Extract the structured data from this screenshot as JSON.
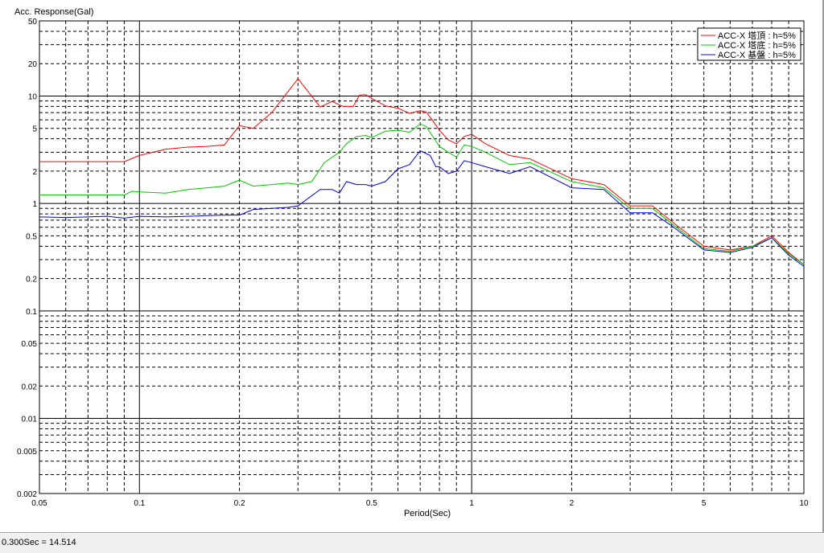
{
  "status_bar": {
    "readout": "0.300Sec = 14.514"
  },
  "chart_data": {
    "type": "line",
    "title": "",
    "ylabel": "Acc. Response(Gal)",
    "xlabel": "Period(Sec)",
    "x_scale": "log",
    "y_scale": "log",
    "xlim": [
      0.05,
      10
    ],
    "ylim": [
      0.002,
      50
    ],
    "grid": true,
    "legend_position": "top-right",
    "x_tick_labels": [
      {
        "value": 0.05,
        "label": "0.05"
      },
      {
        "value": 0.1,
        "label": "0.1"
      },
      {
        "value": 0.2,
        "label": "0.2"
      },
      {
        "value": 0.5,
        "label": "0.5"
      },
      {
        "value": 1,
        "label": "1"
      },
      {
        "value": 2,
        "label": "2"
      },
      {
        "value": 5,
        "label": "5"
      },
      {
        "value": 10,
        "label": "10"
      }
    ],
    "y_tick_labels": [
      {
        "value": 0.002,
        "label": "0.002"
      },
      {
        "value": 0.005,
        "label": "0.005"
      },
      {
        "value": 0.01,
        "label": "0.01"
      },
      {
        "value": 0.02,
        "label": "0.02"
      },
      {
        "value": 0.05,
        "label": "0.05"
      },
      {
        "value": 0.1,
        "label": "0.1"
      },
      {
        "value": 0.2,
        "label": "0.2"
      },
      {
        "value": 0.5,
        "label": "0.5"
      },
      {
        "value": 1,
        "label": "1"
      },
      {
        "value": 2,
        "label": "2"
      },
      {
        "value": 5,
        "label": "5"
      },
      {
        "value": 10,
        "label": "10"
      },
      {
        "value": 20,
        "label": "20"
      },
      {
        "value": 50,
        "label": "50"
      }
    ],
    "series": [
      {
        "name": "ACC-X 塔頂 : h=5%",
        "color": "#ff0000",
        "points": [
          [
            0.05,
            2.45
          ],
          [
            0.06,
            2.45
          ],
          [
            0.07,
            2.45
          ],
          [
            0.08,
            2.45
          ],
          [
            0.09,
            2.45
          ],
          [
            0.1,
            2.8
          ],
          [
            0.12,
            3.2
          ],
          [
            0.14,
            3.35
          ],
          [
            0.16,
            3.4
          ],
          [
            0.18,
            3.5
          ],
          [
            0.2,
            5.3
          ],
          [
            0.22,
            5.0
          ],
          [
            0.25,
            7.0
          ],
          [
            0.3,
            14.5
          ],
          [
            0.35,
            7.9
          ],
          [
            0.38,
            8.9
          ],
          [
            0.41,
            8.0
          ],
          [
            0.44,
            8.0
          ],
          [
            0.46,
            10.2
          ],
          [
            0.48,
            10.3
          ],
          [
            0.5,
            9.5
          ],
          [
            0.55,
            8.1
          ],
          [
            0.6,
            7.7
          ],
          [
            0.65,
            6.9
          ],
          [
            0.7,
            7.3
          ],
          [
            0.73,
            7.1
          ],
          [
            0.76,
            6.0
          ],
          [
            0.8,
            4.8
          ],
          [
            0.85,
            3.9
          ],
          [
            0.9,
            3.6
          ],
          [
            0.95,
            4.2
          ],
          [
            1.0,
            4.4
          ],
          [
            1.1,
            3.6
          ],
          [
            1.3,
            2.8
          ],
          [
            1.5,
            2.6
          ],
          [
            2.0,
            1.7
          ],
          [
            2.5,
            1.5
          ],
          [
            3.0,
            0.95
          ],
          [
            3.5,
            0.95
          ],
          [
            4.0,
            0.68
          ],
          [
            5.0,
            0.4
          ],
          [
            6.0,
            0.37
          ],
          [
            7.0,
            0.4
          ],
          [
            8.0,
            0.5
          ],
          [
            9.0,
            0.35
          ],
          [
            10.0,
            0.27
          ]
        ]
      },
      {
        "name": "ACC-X 塔底 : h=5%",
        "color": "#00c800",
        "points": [
          [
            0.05,
            1.2
          ],
          [
            0.06,
            1.2
          ],
          [
            0.07,
            1.2
          ],
          [
            0.08,
            1.2
          ],
          [
            0.09,
            1.2
          ],
          [
            0.095,
            1.3
          ],
          [
            0.1,
            1.28
          ],
          [
            0.12,
            1.25
          ],
          [
            0.14,
            1.35
          ],
          [
            0.16,
            1.4
          ],
          [
            0.18,
            1.45
          ],
          [
            0.2,
            1.65
          ],
          [
            0.22,
            1.45
          ],
          [
            0.25,
            1.5
          ],
          [
            0.28,
            1.55
          ],
          [
            0.3,
            1.5
          ],
          [
            0.33,
            1.6
          ],
          [
            0.36,
            2.4
          ],
          [
            0.4,
            3.0
          ],
          [
            0.42,
            3.6
          ],
          [
            0.45,
            4.2
          ],
          [
            0.48,
            4.3
          ],
          [
            0.5,
            4.1
          ],
          [
            0.55,
            4.7
          ],
          [
            0.6,
            4.8
          ],
          [
            0.65,
            4.6
          ],
          [
            0.7,
            5.5
          ],
          [
            0.73,
            5.2
          ],
          [
            0.76,
            4.3
          ],
          [
            0.8,
            3.4
          ],
          [
            0.85,
            3.0
          ],
          [
            0.9,
            2.7
          ],
          [
            0.95,
            3.5
          ],
          [
            1.0,
            3.4
          ],
          [
            1.1,
            3.0
          ],
          [
            1.3,
            2.3
          ],
          [
            1.5,
            2.4
          ],
          [
            2.0,
            1.6
          ],
          [
            2.5,
            1.4
          ],
          [
            3.0,
            0.9
          ],
          [
            3.5,
            0.9
          ],
          [
            4.0,
            0.65
          ],
          [
            5.0,
            0.38
          ],
          [
            6.0,
            0.36
          ],
          [
            7.0,
            0.4
          ],
          [
            8.0,
            0.48
          ],
          [
            9.0,
            0.34
          ],
          [
            10.0,
            0.27
          ]
        ]
      },
      {
        "name": "ACC-X 基盤 : h=5%",
        "color": "#0000dc",
        "points": [
          [
            0.05,
            0.75
          ],
          [
            0.06,
            0.74
          ],
          [
            0.07,
            0.75
          ],
          [
            0.08,
            0.76
          ],
          [
            0.09,
            0.73
          ],
          [
            0.1,
            0.76
          ],
          [
            0.12,
            0.75
          ],
          [
            0.14,
            0.76
          ],
          [
            0.16,
            0.77
          ],
          [
            0.18,
            0.78
          ],
          [
            0.2,
            0.78
          ],
          [
            0.22,
            0.88
          ],
          [
            0.25,
            0.9
          ],
          [
            0.28,
            0.92
          ],
          [
            0.3,
            0.95
          ],
          [
            0.35,
            1.35
          ],
          [
            0.38,
            1.35
          ],
          [
            0.4,
            1.25
          ],
          [
            0.42,
            1.6
          ],
          [
            0.45,
            1.5
          ],
          [
            0.48,
            1.5
          ],
          [
            0.5,
            1.45
          ],
          [
            0.55,
            1.6
          ],
          [
            0.6,
            2.1
          ],
          [
            0.65,
            2.3
          ],
          [
            0.7,
            3.1
          ],
          [
            0.75,
            2.8
          ],
          [
            0.78,
            2.2
          ],
          [
            0.8,
            2.2
          ],
          [
            0.85,
            1.9
          ],
          [
            0.9,
            2.0
          ],
          [
            0.95,
            2.5
          ],
          [
            1.0,
            2.4
          ],
          [
            1.1,
            2.2
          ],
          [
            1.3,
            1.9
          ],
          [
            1.5,
            2.2
          ],
          [
            2.0,
            1.4
          ],
          [
            2.5,
            1.35
          ],
          [
            3.0,
            0.82
          ],
          [
            3.5,
            0.82
          ],
          [
            4.0,
            0.62
          ],
          [
            5.0,
            0.37
          ],
          [
            6.0,
            0.35
          ],
          [
            7.0,
            0.39
          ],
          [
            8.0,
            0.48
          ],
          [
            9.0,
            0.33
          ],
          [
            10.0,
            0.26
          ]
        ]
      }
    ]
  }
}
